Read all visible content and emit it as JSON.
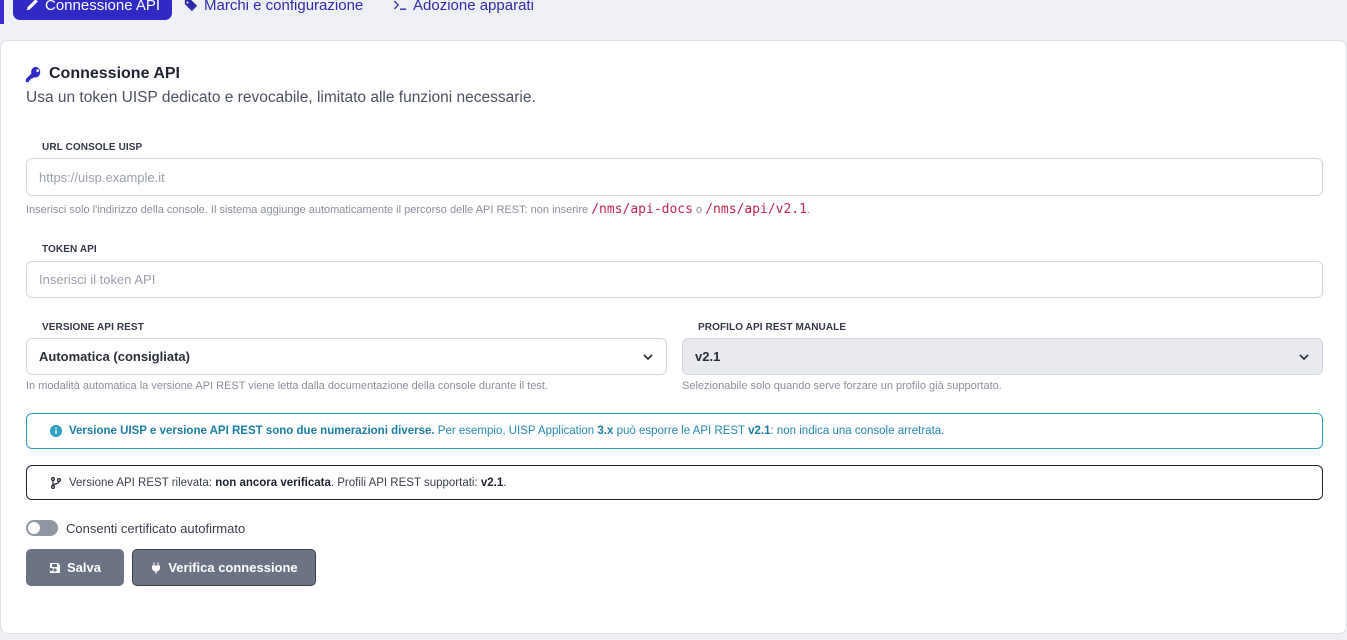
{
  "tabs": [
    {
      "label": "Connessione API",
      "icon": "pencil-icon",
      "active": true
    },
    {
      "label": "Marchi e configurazione",
      "icon": "tag-icon",
      "active": false
    },
    {
      "label": "Adozione apparati",
      "icon": "terminal-icon",
      "active": false
    }
  ],
  "section": {
    "title": "Connessione API",
    "subtitle": "Usa un token UISP dedicato e revocabile, limitato alle funzioni necessarie."
  },
  "url_field": {
    "label": "URL CONSOLE UISP",
    "placeholder": "https://uisp.example.it",
    "hint_prefix": "Inserisci solo l'indirizzo della console. Il sistema aggiunge automaticamente il percorso delle API REST: non inserire",
    "hint_code1": "/nms/api-docs",
    "hint_or": "o",
    "hint_code2": "/nms/api/v2.1",
    "hint_suffix": "."
  },
  "token_field": {
    "label": "TOKEN API",
    "placeholder": "Inserisci il token API"
  },
  "version_field": {
    "label": "VERSIONE API REST",
    "value": "Automatica (consigliata)",
    "hint": "In modalità automatica la versione API REST viene letta dalla documentazione della console durante il test."
  },
  "profile_field": {
    "label": "PROFILO API REST MANUALE",
    "value": "v2.1",
    "hint": "Selezionabile solo quando serve forzare un profilo già supportato."
  },
  "info_alert": {
    "bold": "Versione UISP e versione API REST sono due numerazioni diverse.",
    "text1": "Per esempio, UISP Application",
    "bold2": "3.x",
    "text2": "può esporre le API REST",
    "bold3": "v2.1",
    "text3": ": non indica una console arretrata."
  },
  "status_box": {
    "text1": "Versione API REST rilevata:",
    "bold1": "non ancora verificata",
    "text2": ". Profili API REST supportati:",
    "bold2": "v2.1",
    "text3": "."
  },
  "toggle": {
    "label": "Consenti certificato autofirmato",
    "checked": false
  },
  "buttons": {
    "save": "Salva",
    "verify": "Verifica connessione"
  },
  "colors": {
    "accent": "#2f2ac4",
    "info": "#2c9fc4",
    "code": "#c7254e",
    "button": "#6c7385"
  }
}
